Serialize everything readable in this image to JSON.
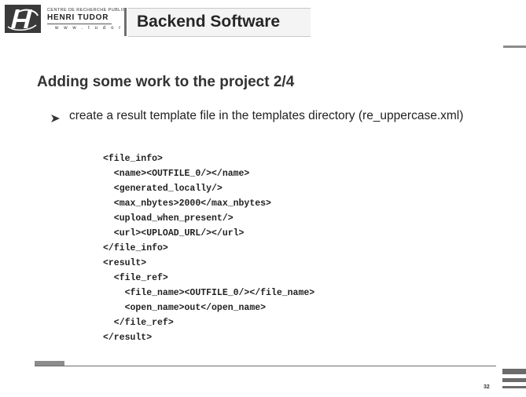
{
  "logo": {
    "small_text": "CENTRE DE RECHERCHE PUBLIC",
    "name": "HENRI TUDOR",
    "url": "w w w . t u d o r . l u"
  },
  "header": {
    "title": "Backend Software"
  },
  "slide": {
    "heading": "Adding some work to the project 2/4",
    "bullet": "create a result template file in the templates directory (re_uppercase.xml)",
    "code_lines": [
      "<file_info>",
      "  <name><OUTFILE_0/></name>",
      "  <generated_locally/>",
      "  <max_nbytes>2000</max_nbytes>",
      "  <upload_when_present/>",
      "  <url><UPLOAD_URL/></url>",
      "</file_info>",
      "<result>",
      "  <file_ref>",
      "    <file_name><OUTFILE_0/></file_name>",
      "    <open_name>out</open_name>",
      "  </file_ref>",
      "</result>"
    ],
    "page_number": "32"
  },
  "icons": {
    "logo": "tudor-logo-icon",
    "bullet": "arrowhead-bullet-icon"
  }
}
